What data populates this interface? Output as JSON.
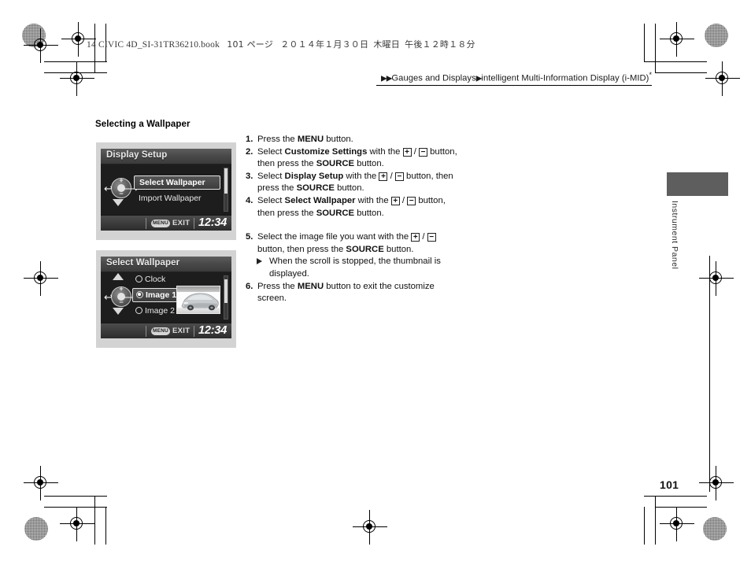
{
  "running_header": {
    "text": "14 CIVIC 4D_SI-31TR36210.book",
    "page_label": "101 ページ",
    "date": "２０１４年１月３０日",
    "weekday": "木曜日",
    "time": "午後１２時１８分"
  },
  "breadcrumb": {
    "arrow1": "▶▶",
    "level1": "Gauges and Displays",
    "arrow2": "▶",
    "level2": "intelligent Multi-Information Display (i-MID)",
    "footnote_marker": "*"
  },
  "section": {
    "title": "Selecting a Wallpaper"
  },
  "screens": [
    {
      "name": "display-setup-screen",
      "title": "Display Setup",
      "rows": [
        {
          "label": "Select Wallpaper",
          "selected": true,
          "radio": false
        },
        {
          "label": "Import Wallpaper",
          "selected": false,
          "radio": false
        }
      ],
      "has_up_arrow": false,
      "has_down_arrow": true,
      "has_thumbnail": false,
      "footer": {
        "menu_badge": "MENU",
        "exit_label": "EXIT",
        "clock": "12:34"
      }
    },
    {
      "name": "select-wallpaper-screen",
      "title": "Select Wallpaper",
      "rows": [
        {
          "label": "Clock",
          "selected": false,
          "radio": true,
          "radio_on": false
        },
        {
          "label": "Image 1",
          "selected": true,
          "radio": true,
          "radio_on": true
        },
        {
          "label": "Image 2",
          "selected": false,
          "radio": true,
          "radio_on": false
        }
      ],
      "has_up_arrow": true,
      "has_down_arrow": true,
      "has_thumbnail": true,
      "thumbnail_alt": "silver sedan wallpaper thumbnail",
      "footer": {
        "menu_badge": "MENU",
        "exit_label": "EXIT",
        "clock": "12:34"
      }
    }
  ],
  "steps": [
    {
      "num": "1.",
      "parts": [
        {
          "t": "Press the "
        },
        {
          "t": "MENU",
          "b": true
        },
        {
          "t": " button."
        }
      ]
    },
    {
      "num": "2.",
      "parts": [
        {
          "t": "Select "
        },
        {
          "t": "Customize Settings",
          "b": true
        },
        {
          "t": " with the "
        },
        {
          "t": "+",
          "key": true
        },
        {
          "t": " / "
        },
        {
          "t": "−",
          "key": true
        },
        {
          "t": " button, then press the "
        },
        {
          "t": "SOURCE",
          "b": true
        },
        {
          "t": " button."
        }
      ]
    },
    {
      "num": "3.",
      "parts": [
        {
          "t": "Select "
        },
        {
          "t": "Display Setup",
          "b": true
        },
        {
          "t": " with the "
        },
        {
          "t": "+",
          "key": true
        },
        {
          "t": " / "
        },
        {
          "t": "−",
          "key": true
        },
        {
          "t": " button, then press the "
        },
        {
          "t": "SOURCE",
          "b": true
        },
        {
          "t": " button."
        }
      ]
    },
    {
      "num": "4.",
      "parts": [
        {
          "t": "Select "
        },
        {
          "t": "Select Wallpaper",
          "b": true
        },
        {
          "t": " with the "
        },
        {
          "t": "+",
          "key": true
        },
        {
          "t": " / "
        },
        {
          "t": "−",
          "key": true
        },
        {
          "t": " button, then press the "
        },
        {
          "t": "SOURCE",
          "b": true
        },
        {
          "t": " button."
        }
      ]
    },
    {
      "num": "5.",
      "parts": [
        {
          "t": "Select the image file you want with the "
        },
        {
          "t": "+",
          "key": true
        },
        {
          "t": " / "
        },
        {
          "t": "−",
          "key": true
        },
        {
          "t": " button, then press the "
        },
        {
          "t": "SOURCE",
          "b": true
        },
        {
          "t": " button."
        }
      ],
      "sub": "When the scroll is stopped, the thumbnail is displayed."
    },
    {
      "num": "6.",
      "parts": [
        {
          "t": "Press the "
        },
        {
          "t": "MENU",
          "b": true
        },
        {
          "t": " button to exit the customize screen."
        }
      ]
    }
  ],
  "side_tab": {
    "label": "Instrument Panel"
  },
  "page_number": "101"
}
